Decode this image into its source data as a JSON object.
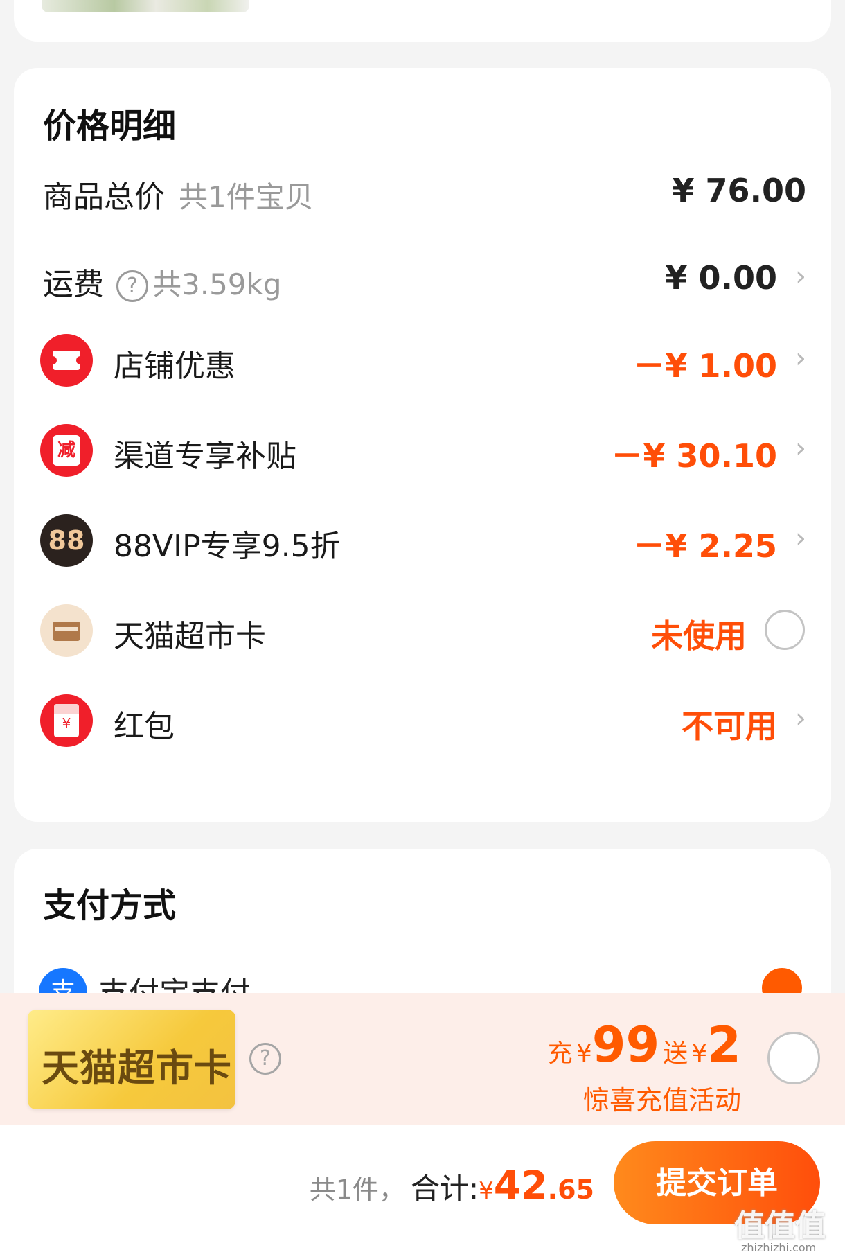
{
  "price_section": {
    "title": "价格明细",
    "goods_total": {
      "label": "商品总价",
      "sub": "共1件宝贝",
      "value": "¥ 76.00"
    },
    "shipping": {
      "label": "运费",
      "sub": "共3.59kg",
      "value": "¥ 0.00"
    },
    "shop_discount": {
      "label": "店铺优惠",
      "value": "－¥ 1.00"
    },
    "channel_subsidy": {
      "label": "渠道专享补贴",
      "icon_text": "减",
      "value": "－¥ 30.10"
    },
    "vip_discount": {
      "label": "88VIP专享9.5折",
      "icon_text": "88",
      "value": "－¥ 2.25"
    },
    "tmall_card": {
      "label": "天猫超市卡",
      "value": "未使用"
    },
    "red_packet": {
      "label": "红包",
      "icon_text": "¥",
      "value": "不可用"
    }
  },
  "payment_section": {
    "title": "支付方式",
    "method_label": "支付宝支付",
    "method_icon_text": "支"
  },
  "promo_banner": {
    "tag": "天猫超市卡",
    "offer_prefix": "充",
    "offer_currency": "¥",
    "offer_amount": "99",
    "offer_gift_prefix": "送",
    "offer_gift_amount": "2",
    "subtitle": "惊喜充值活动"
  },
  "bottom_bar": {
    "count": "共1件，",
    "total_label": "合计:",
    "currency": "¥",
    "total_int": "42",
    "total_dec": ".65",
    "submit_label": "提交订单"
  },
  "watermark": {
    "text": "值值值",
    "url": "zhizhizhi.com"
  },
  "colors": {
    "accent": "#ff4e08",
    "discount_icon": "#f01f2a",
    "background": "#f4f4f4"
  }
}
